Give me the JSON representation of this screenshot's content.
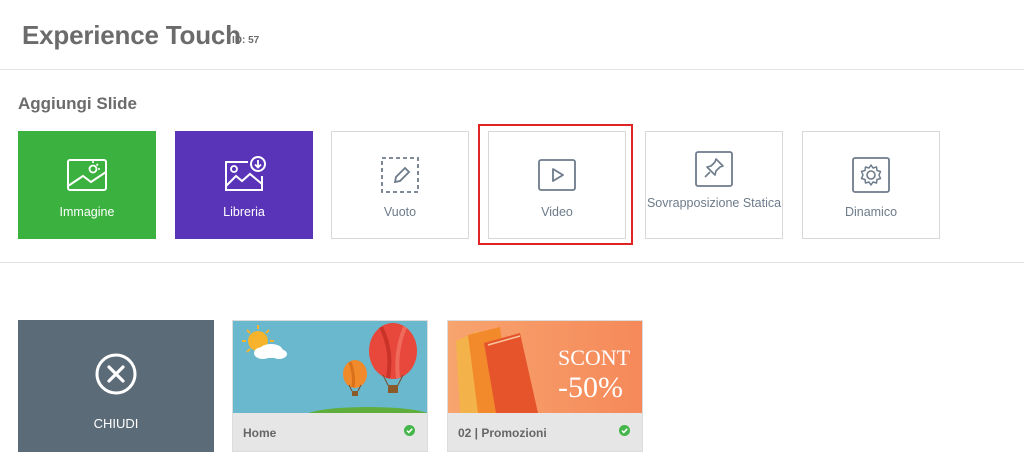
{
  "header": {
    "title": "Experience Touch",
    "id_label": "ID: 57"
  },
  "add_slide": {
    "title": "Aggiungi Slide",
    "tiles": [
      {
        "label": "Immagine",
        "icon": "image-icon",
        "color": "#3bb13f"
      },
      {
        "label": "Libreria",
        "icon": "library-icon",
        "color": "#5a34b8"
      },
      {
        "label": "Vuoto",
        "icon": "empty-icon"
      },
      {
        "label": "Video",
        "icon": "video-icon",
        "highlighted": true
      },
      {
        "label": "Sovrapposizione Statica",
        "icon": "pin-icon"
      },
      {
        "label": "Dinamico",
        "icon": "gear-icon"
      }
    ],
    "highlight_color": "#e02424"
  },
  "slides": {
    "close": {
      "label": "CHIUDI",
      "icon": "close-icon",
      "color": "#5c6b78"
    },
    "items": [
      {
        "name": "Home",
        "status": "active"
      },
      {
        "name": "02 | Promozioni",
        "status": "active",
        "thumb_text_1": "SCONT",
        "thumb_text_2": "-50%"
      }
    ],
    "status_color": "#45b649"
  }
}
